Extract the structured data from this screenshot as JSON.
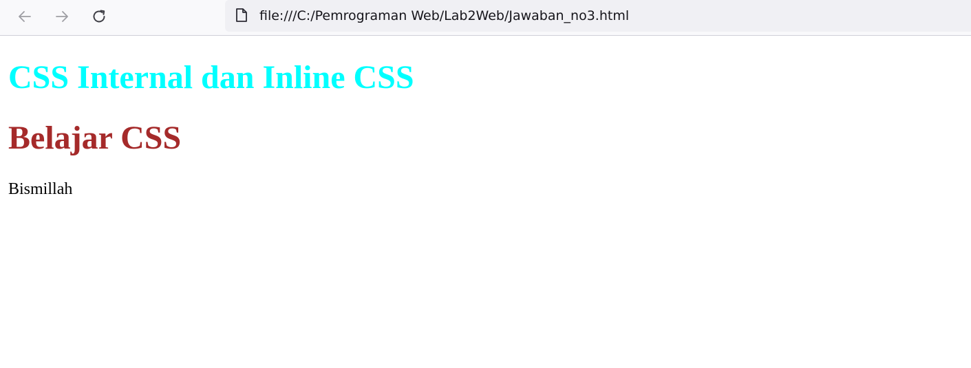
{
  "browser": {
    "url": "file:///C:/Pemrograman Web/Lab2Web/Jawaban_no3.html",
    "icons": {
      "back": "arrow-left-icon",
      "forward": "arrow-right-icon",
      "reload": "reload-icon",
      "page": "page-icon"
    }
  },
  "page": {
    "heading1": "CSS Internal dan Inline CSS",
    "heading2": "Belajar CSS",
    "paragraph": "Bismillah"
  },
  "colors": {
    "heading1": "#00ffff",
    "heading2": "#a52a2a",
    "paragraph": "#000000"
  }
}
